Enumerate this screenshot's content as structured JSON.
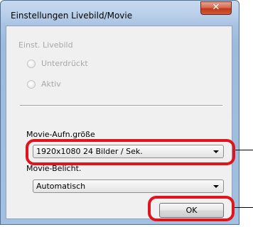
{
  "window": {
    "title": "Einstellungen Livebild/Movie",
    "close_glyph": "✕"
  },
  "liveview": {
    "group_label": "Einst. Livebild",
    "options": [
      {
        "label": "Unterdrückt"
      },
      {
        "label": "Aktiv"
      }
    ]
  },
  "movie": {
    "size_label": "Movie-Aufn.größe",
    "size_value": "1920x1080  24 Bilder / Sek.",
    "exposure_label": "Movie-Belicht.",
    "exposure_value": "Automatisch"
  },
  "buttons": {
    "ok_label": "OK"
  },
  "colors": {
    "highlight": "#e0141c",
    "window_frame": "#a9c3e2",
    "disabled_text": "#a8a8a8"
  }
}
